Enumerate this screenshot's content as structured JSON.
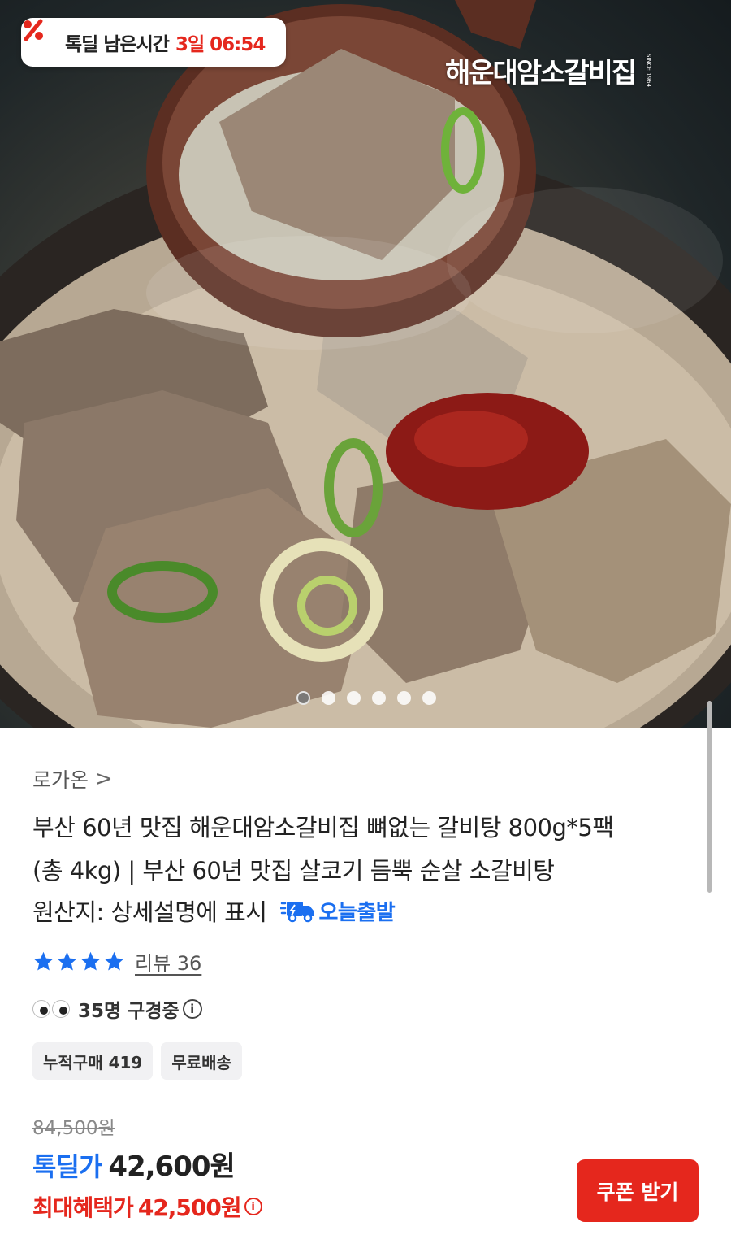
{
  "hero": {
    "timer_label": "톡딜 남은시간",
    "timer_value": "3일 06:54",
    "brand_logo": "해운대암소갈비집",
    "brand_since": "SINCE 1964",
    "carousel": {
      "count": 6,
      "active_index": 0
    }
  },
  "product": {
    "seller": "로가온",
    "seller_chevron": ">",
    "title_line1": "부산 60년 맛집 해운대암소갈비집 뼈없는 갈비탕 800g*5팩",
    "title_line2": "(총 4kg) | 부산 60년 맛집 살코기 듬뿍 순살 소갈비탕",
    "title_line3": "원산지: 상세설명에 표시",
    "shipping_tag": "오늘출발",
    "rating": {
      "stars": 4,
      "max": 4,
      "review_text": "리뷰 36"
    },
    "viewers_text": "35명 구경중",
    "chips": [
      "누적구매 419",
      "무료배송"
    ]
  },
  "price": {
    "original": "84,500원",
    "deal_label": "톡딜가",
    "deal_price": "42,600원",
    "max_label": "최대혜택가",
    "max_price": "42,500원",
    "coupon_button": "쿠폰 받기"
  },
  "colors": {
    "accent_blue": "#1b6ff0",
    "accent_red": "#e5271d",
    "star": "#1b6ff0"
  },
  "icons": {
    "timer": "percent-icon",
    "shipping": "truck-icon",
    "star": "star-icon",
    "viewers": "eyes-icon",
    "info": "info-icon"
  }
}
